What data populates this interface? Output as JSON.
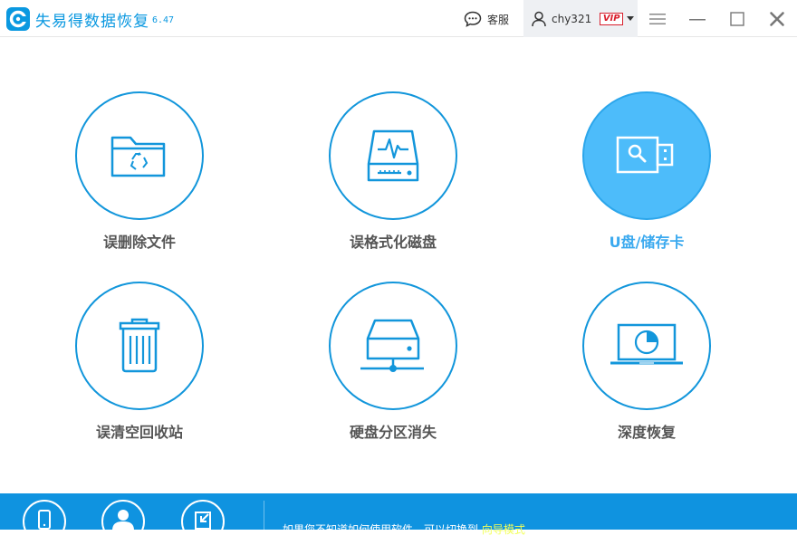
{
  "app": {
    "name": "失易得数据恢复",
    "version": "6.47"
  },
  "titlebar": {
    "support_label": "客服",
    "username": "chy321",
    "vip_badge": "VIP"
  },
  "tiles": [
    {
      "label": "误删除文件",
      "icon": "folder-recycle-icon",
      "active": false
    },
    {
      "label": "误格式化磁盘",
      "icon": "hard-drive-pulse-icon",
      "active": false
    },
    {
      "label": "U盘/储存卡",
      "icon": "usb-drive-icon",
      "active": true
    },
    {
      "label": "误清空回收站",
      "icon": "trash-bin-icon",
      "active": false
    },
    {
      "label": "硬盘分区消失",
      "icon": "network-drive-icon",
      "active": false
    },
    {
      "label": "深度恢复",
      "icon": "laptop-disk-icon",
      "active": false
    }
  ],
  "footer": {
    "hint_text": "如果您不知道如何使用软件，可以切换到",
    "hint_link": "向导模式"
  },
  "colors": {
    "brand": "#0a98e0",
    "accent_active": "#4dbcfa",
    "footer": "#0f93e0",
    "vip": "#d81e2c",
    "link": "#f2ff5a"
  }
}
